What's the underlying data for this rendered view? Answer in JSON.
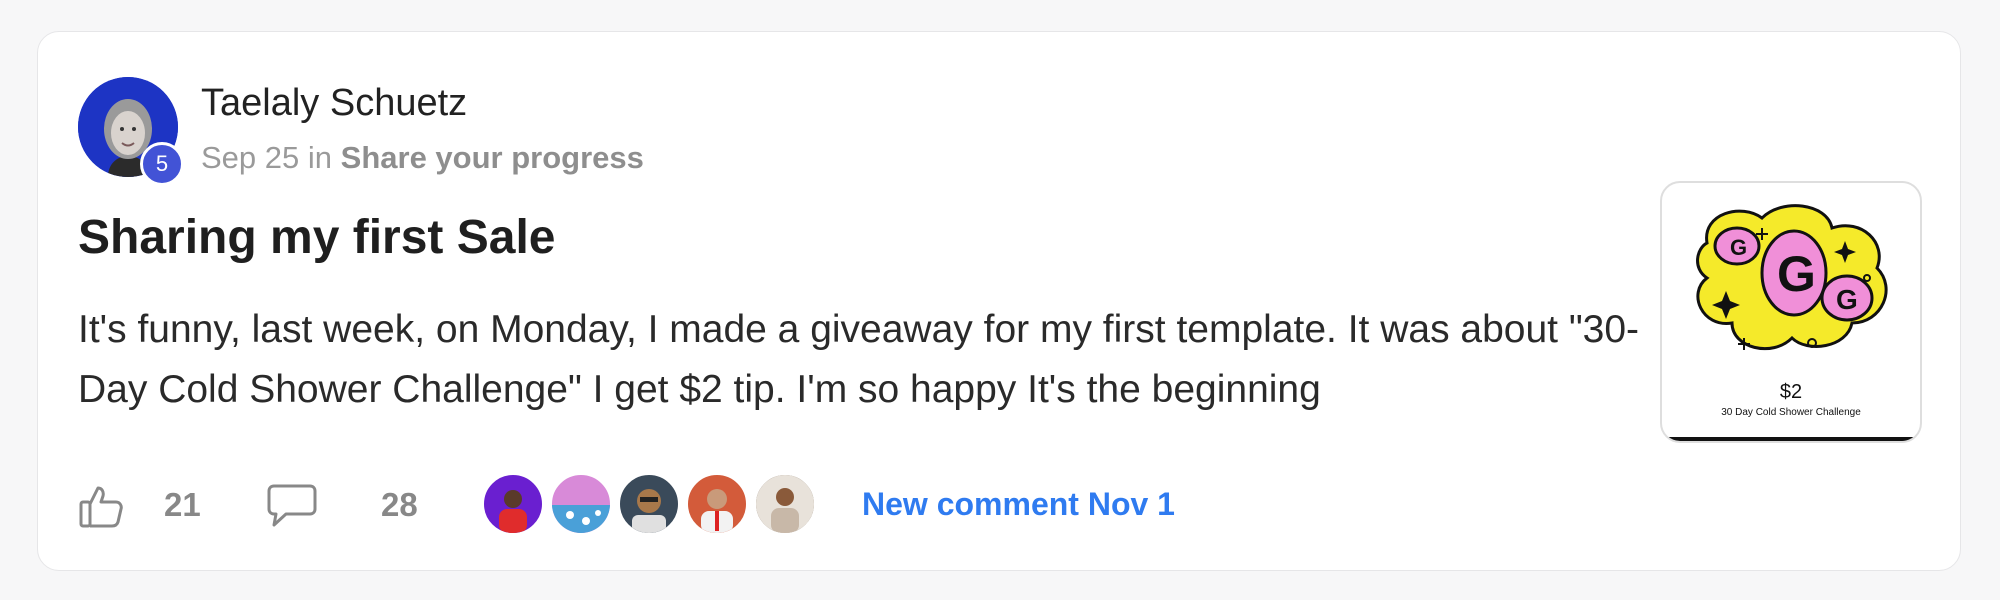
{
  "post": {
    "author": "Taelaly Schuetz",
    "level": "5",
    "date": "Sep 25",
    "in_word": "in",
    "category": "Share your progress",
    "title": "Sharing my first Sale",
    "body": "It's funny, last week, on Monday, I made a giveaway for my first template. It was about \"30-Day Cold Shower Challenge\" I get $2 tip. I'm so happy It's the beginning"
  },
  "thumbnail": {
    "price": "$2",
    "caption": "30 Day Cold Shower Challenge",
    "colors": {
      "blob": "#f5ea2a",
      "letters": "#f08fd8",
      "outline": "#111111"
    }
  },
  "actions": {
    "likes": "21",
    "comments": "28",
    "new_comment": "New comment Nov 1",
    "like_icon": "thumbs-up-icon",
    "comment_icon": "speech-bubble-icon"
  },
  "commenters": [
    {
      "name": "commenter-1",
      "color": "#6a1fd0"
    },
    {
      "name": "commenter-2",
      "color": "#d88ad8"
    },
    {
      "name": "commenter-3",
      "color": "#3a4a5a"
    },
    {
      "name": "commenter-4",
      "color": "#d35b3a"
    },
    {
      "name": "commenter-5",
      "color": "#8a7a6a"
    }
  ],
  "colors": {
    "accent": "#2f7bf0",
    "badge": "#4253d6",
    "avatar_bg": "#1d34c4"
  }
}
